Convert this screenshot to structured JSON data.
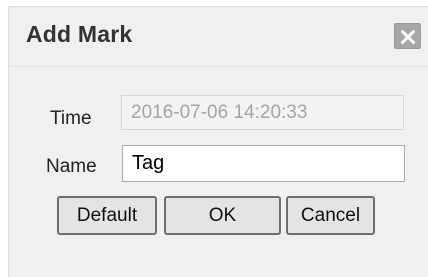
{
  "dialog": {
    "title": "Add Mark",
    "close_icon": "close-icon"
  },
  "form": {
    "time_label": "Time",
    "time_value": "2016-07-06 14:20:33",
    "name_label": "Name",
    "name_value": "Tag"
  },
  "buttons": {
    "default_label": "Default",
    "ok_label": "OK",
    "cancel_label": "Cancel"
  },
  "colors": {
    "dialog_bg": "#f0f0f0",
    "close_button_bg": "#a7a7a7",
    "disabled_text": "#a5a5a5"
  }
}
